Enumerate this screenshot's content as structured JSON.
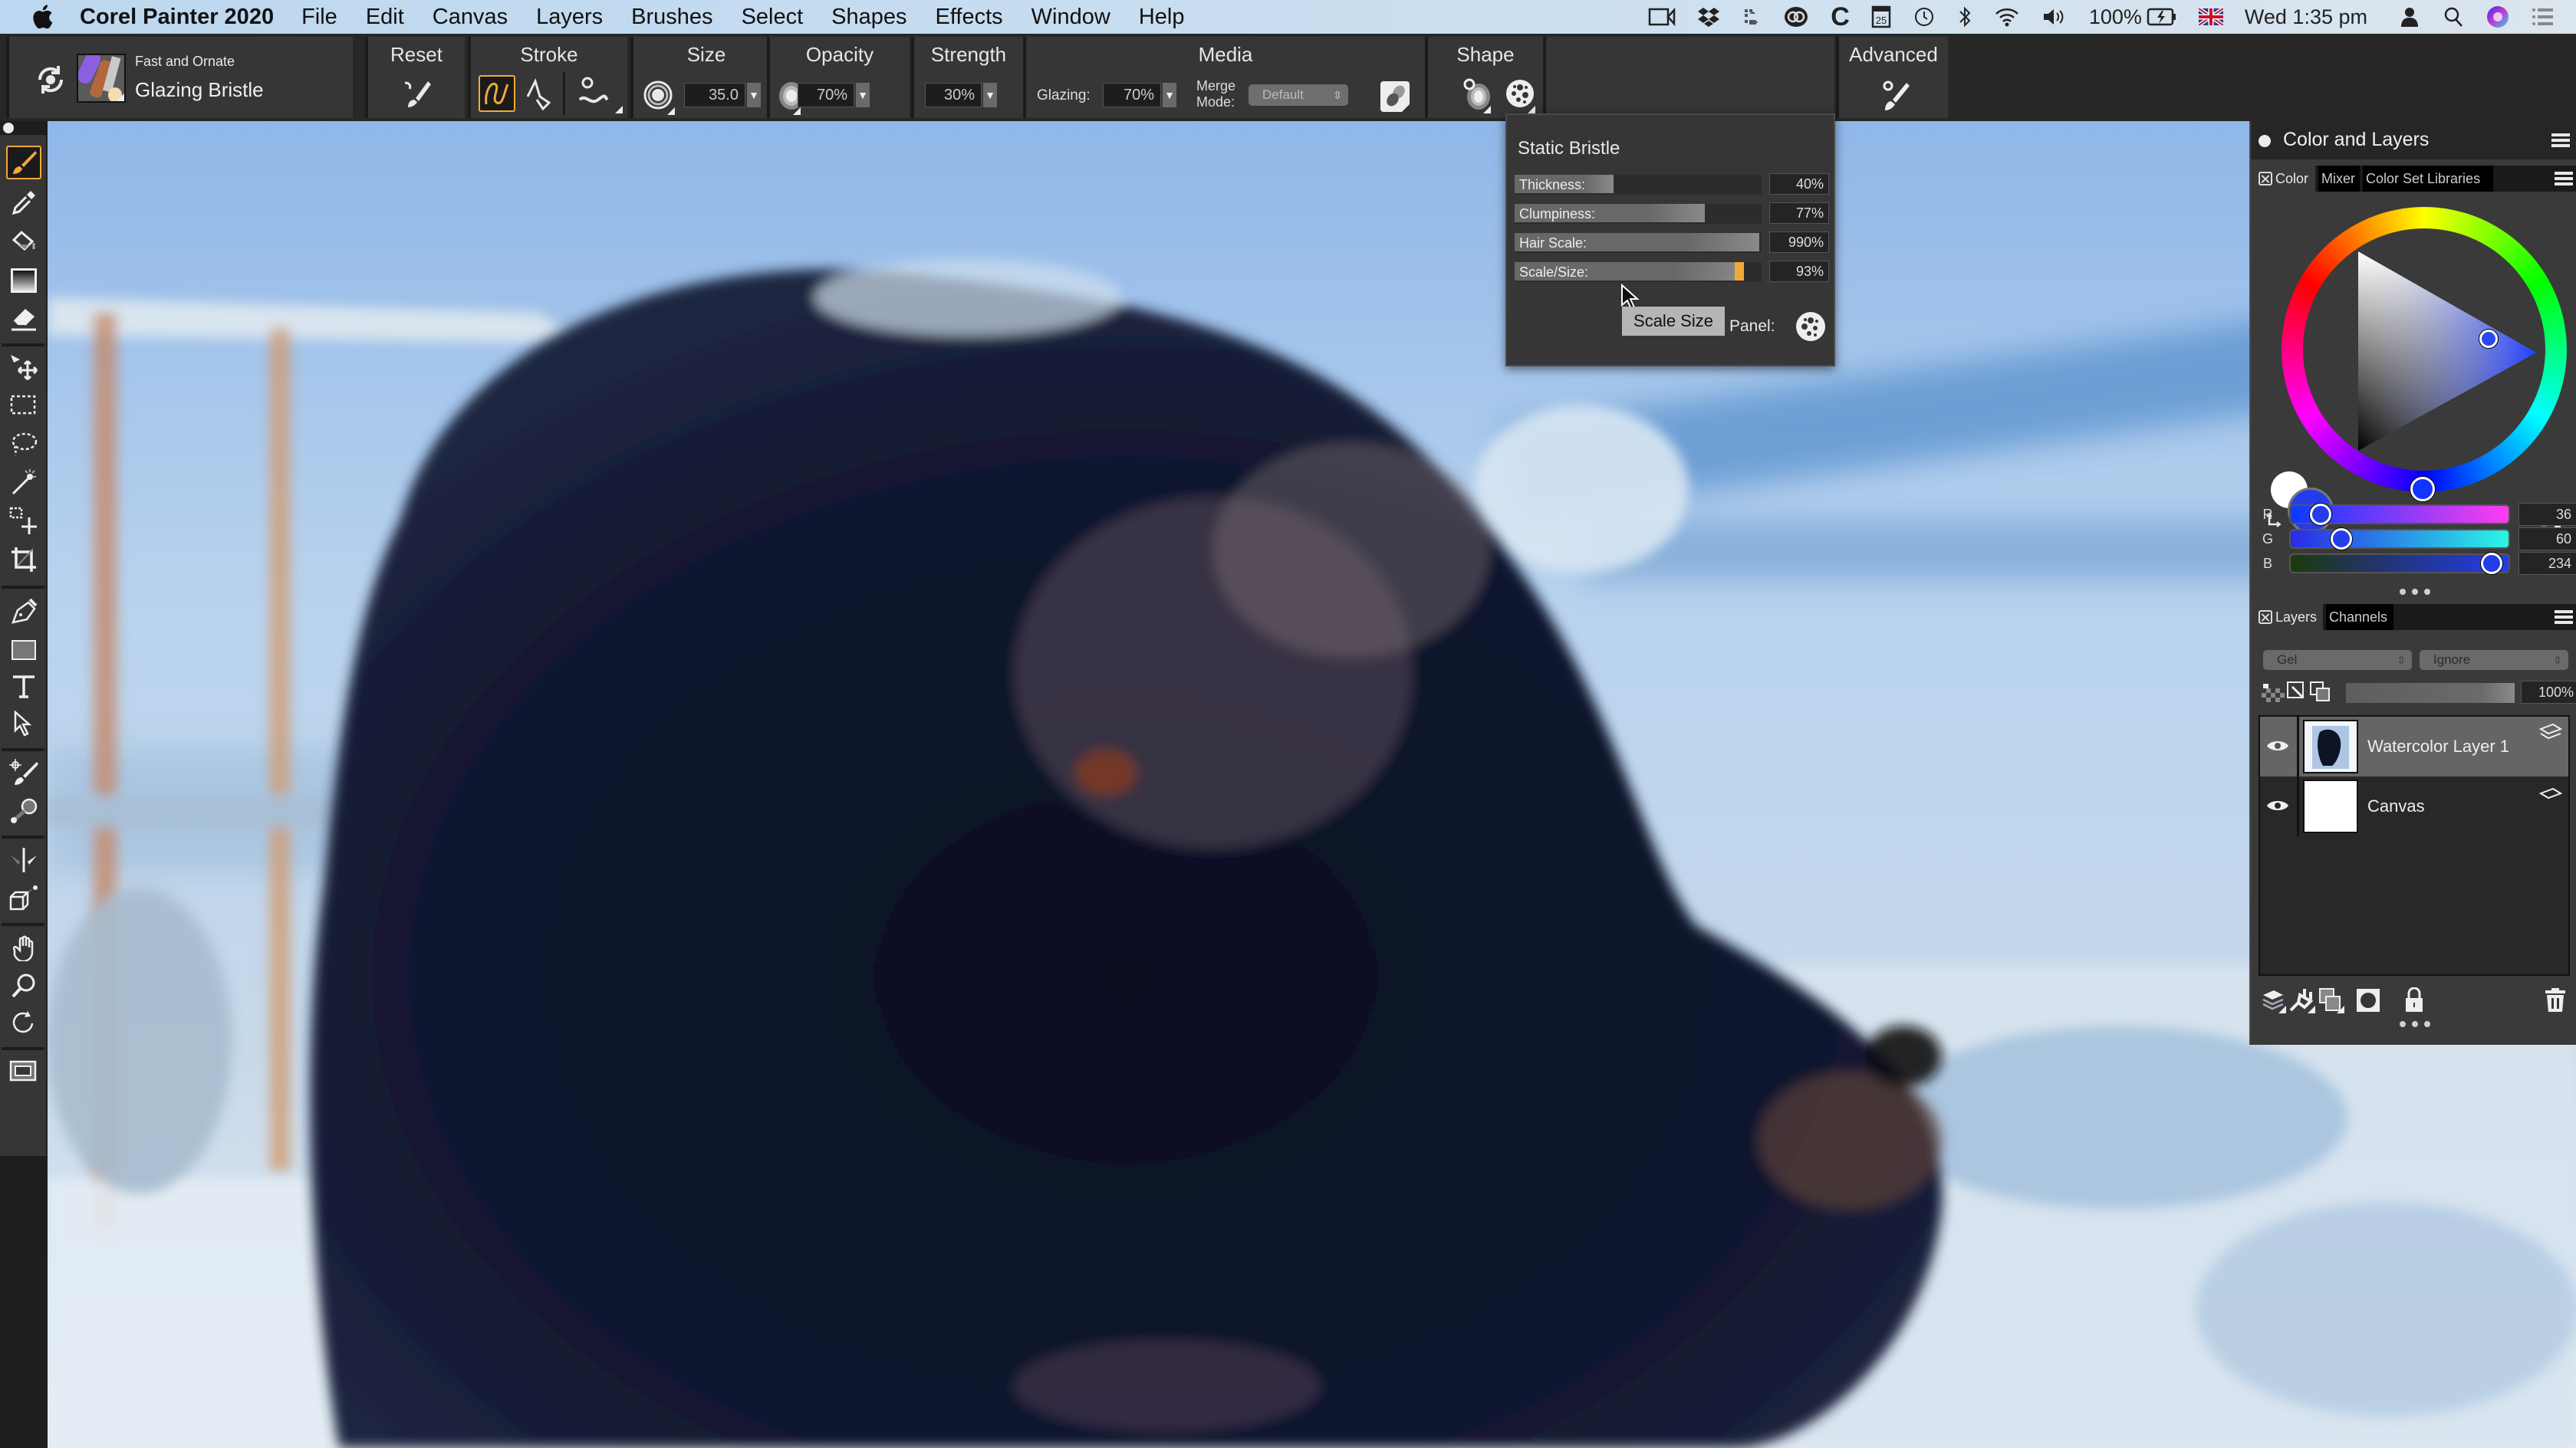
{
  "menubar": {
    "app_name": "Corel Painter 2020",
    "menus": [
      "File",
      "Edit",
      "Canvas",
      "Layers",
      "Brushes",
      "Select",
      "Shapes",
      "Effects",
      "Window",
      "Help"
    ],
    "status_icons": [
      "screen-record-icon",
      "dropbox-icon",
      "transfer-icon",
      "creative-cloud-icon",
      "c-app-icon",
      "calendar-icon",
      "time-machine-icon",
      "bluetooth-icon",
      "wifi-icon",
      "volume-icon"
    ],
    "calendar_day": "25",
    "battery": "100%",
    "clock": "Wed 1:35 pm"
  },
  "toolbar": {
    "brush_category": "Fast and Ornate",
    "brush_variant": "Glazing Bristle",
    "reset_label": "Reset",
    "stroke_label": "Stroke",
    "size_label": "Size",
    "size_value": "35.0",
    "opacity_label": "Opacity",
    "opacity_value": "70%",
    "strength_label": "Strength",
    "strength_value": "30%",
    "media_label": "Media",
    "glazing_label": "Glazing:",
    "glazing_value": "70%",
    "merge_mode_label_1": "Merge",
    "merge_mode_label_2": "Mode:",
    "merge_mode_value": "Default",
    "shape_label": "Shape",
    "advanced_label": "Advanced"
  },
  "toolbox": {
    "active_tool": "brush",
    "tools": [
      "brush",
      "dropper",
      "paint-bucket",
      "gradient",
      "eraser",
      "layer-adjuster",
      "rectangular-selection",
      "lasso",
      "magic-wand",
      "transform",
      "crop",
      "pen",
      "rectangle-shape",
      "text",
      "shape-selection",
      "cloner",
      "blender",
      "mirror-painting",
      "perspective-guides",
      "grabber",
      "magnifier",
      "rotate-page",
      "screen-mode"
    ]
  },
  "bristle_panel": {
    "title": "Static Bristle",
    "sliders": [
      {
        "label": "Thickness:",
        "value": "40%",
        "fraction": 0.4
      },
      {
        "label": "Clumpiness:",
        "value": "77%",
        "fraction": 0.77
      },
      {
        "label": "Hair Scale:",
        "value": "990%",
        "fraction": 0.99
      },
      {
        "label": "Scale/Size:",
        "value": "93%",
        "fraction": 0.93
      }
    ],
    "tooltip": "Scale Size",
    "panel_label": "Panel:"
  },
  "color_layers": {
    "title": "Color and Layers",
    "color_tabs": [
      "Color",
      "Mixer",
      "Color Set Libraries"
    ],
    "color_hex": "#243CEA",
    "rgb": [
      {
        "channel": "R",
        "value": "36",
        "fraction": 0.141
      },
      {
        "channel": "G",
        "value": "60",
        "fraction": 0.235
      },
      {
        "channel": "B",
        "value": "234",
        "fraction": 0.918
      }
    ],
    "layer_tabs": [
      "Layers",
      "Channels"
    ],
    "composite_method": "Gel",
    "composite_depth": "Ignore",
    "opacity": "100%",
    "layers": [
      {
        "name": "Watercolor Layer 1",
        "selected": true,
        "visible": true
      },
      {
        "name": "Canvas",
        "selected": false,
        "visible": true
      }
    ]
  },
  "colors": {
    "accent": "#F2A93B",
    "panel_bg": "#363636",
    "current_color": "#243CEA"
  }
}
